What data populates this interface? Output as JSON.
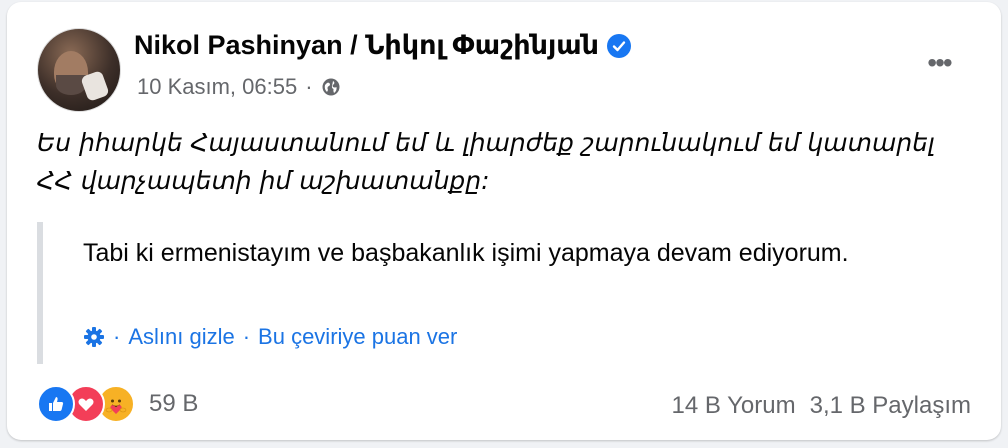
{
  "post": {
    "author": "Nikol Pashinyan / Նիկոլ Փաշինյան",
    "verified_icon": "verified-badge-icon",
    "timestamp": "10 Kasım, 06:55",
    "dot": "·",
    "privacy_icon": "globe-icon",
    "more_label": "•••",
    "original_text": "Ես իհարկե Հայաստանում եմ և լիարժեք շարունակում եմ կատարել ՀՀ վարչապետի իմ աշխատանքը:",
    "translation": {
      "text": "Tabi ki ermenistayım ve başbakanlık işimi yapmaya devam ediyorum.",
      "settings_icon": "gear-icon",
      "separator": "·",
      "hide_original": "Aslını gizle",
      "rate_translation": "Bu çeviriye puan ver"
    },
    "reactions": {
      "types": [
        "like",
        "love",
        "care"
      ],
      "count": "59 B"
    },
    "comments": "14 B Yorum",
    "shares": "3,1 B Paylaşım"
  },
  "colors": {
    "accent": "#1877f2",
    "link": "#1b74e4",
    "secondary_text": "#65676b",
    "love": "#f33e58",
    "care": "#f7b125"
  }
}
